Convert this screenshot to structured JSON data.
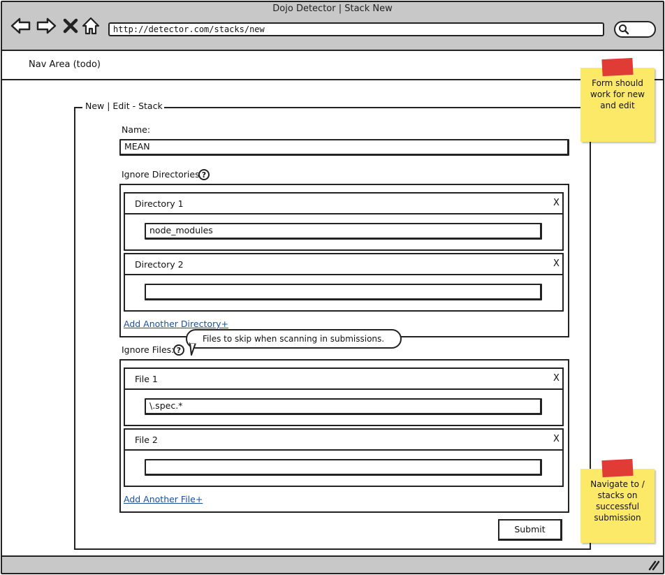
{
  "window": {
    "title": "Dojo Detector | Stack New",
    "url": "http://detector.com/stacks/new"
  },
  "toolbar": {
    "back_icon": "back-arrow-icon",
    "forward_icon": "forward-arrow-icon",
    "stop_icon": "close-x-icon",
    "home_icon": "home-icon",
    "search_icon": "search-icon"
  },
  "nav": {
    "label": "Nav Area (todo)"
  },
  "form": {
    "legend": "New | Edit - Stack",
    "name_label": "Name:",
    "name_value": "MEAN",
    "ignore_dirs_label": "Ignore Directories:",
    "help_glyph": "?",
    "directories": [
      {
        "title": "Directory 1",
        "value": "node_modules",
        "close": "X"
      },
      {
        "title": "Directory 2",
        "value": "",
        "close": "X"
      }
    ],
    "add_directory_link": "Add Another Directory+",
    "ignore_files_label": "Ignore Files:",
    "files_tooltip": "Files to skip when scanning in submissions.",
    "files": [
      {
        "title": "File 1",
        "value": "\\.spec.*",
        "close": "X"
      },
      {
        "title": "File 2",
        "value": "",
        "close": "X"
      }
    ],
    "add_file_link": "Add Another File+",
    "submit_label": "Submit"
  },
  "notes": {
    "top": "Form should work for new and edit",
    "bottom": "Navigate to / stacks on successful submission"
  },
  "colors": {
    "chrome": "#c8c8c8",
    "sticky": "#fde968",
    "tape": "#e03b35",
    "link": "#1a4f9c"
  }
}
